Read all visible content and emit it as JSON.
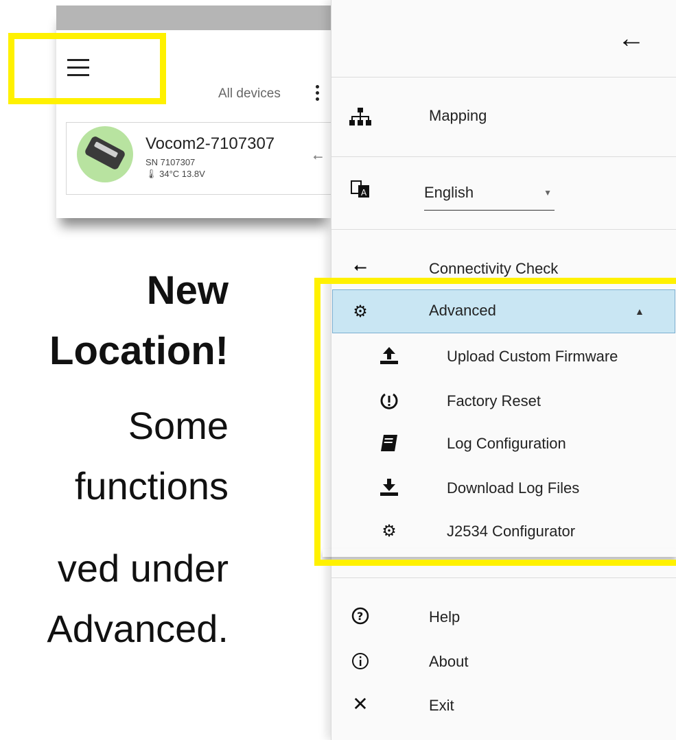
{
  "device_panel": {
    "filter_label": "All devices",
    "device": {
      "name": "Vocom2-7107307",
      "serial": "SN 7107307",
      "stats": "34°C  13.8V"
    }
  },
  "callout": {
    "line1": "New",
    "line2": "Location!",
    "line3": "Some",
    "line4": "functions",
    "line5": "ved under",
    "line6": "Advanced."
  },
  "menu": {
    "back_icon": "arrow-left-icon",
    "items": [
      {
        "label": "Mapping",
        "icon": "sitemap-icon"
      },
      {
        "label": "Connectivity Check",
        "icon": "usb-icon"
      },
      {
        "label": "Advanced",
        "icon": "cogs-icon"
      }
    ],
    "language": {
      "selected": "English",
      "icon": "translate-icon"
    },
    "advanced_items": [
      {
        "label": "Upload Custom Firmware",
        "icon": "upload-icon"
      },
      {
        "label": "Factory Reset",
        "icon": "reset-icon"
      },
      {
        "label": "Log Configuration",
        "icon": "book-icon"
      },
      {
        "label": "Download Log Files",
        "icon": "download-icon"
      },
      {
        "label": "J2534 Configurator",
        "icon": "gear-icon"
      }
    ],
    "footer_items": [
      {
        "label": "Help",
        "icon": "help-icon"
      },
      {
        "label": "About",
        "icon": "info-icon"
      },
      {
        "label": "Exit",
        "icon": "close-icon"
      }
    ]
  },
  "colors": {
    "highlight": "#fff100",
    "advanced_bg": "#c9e6f3",
    "device_avatar": "#b8e3a0"
  }
}
